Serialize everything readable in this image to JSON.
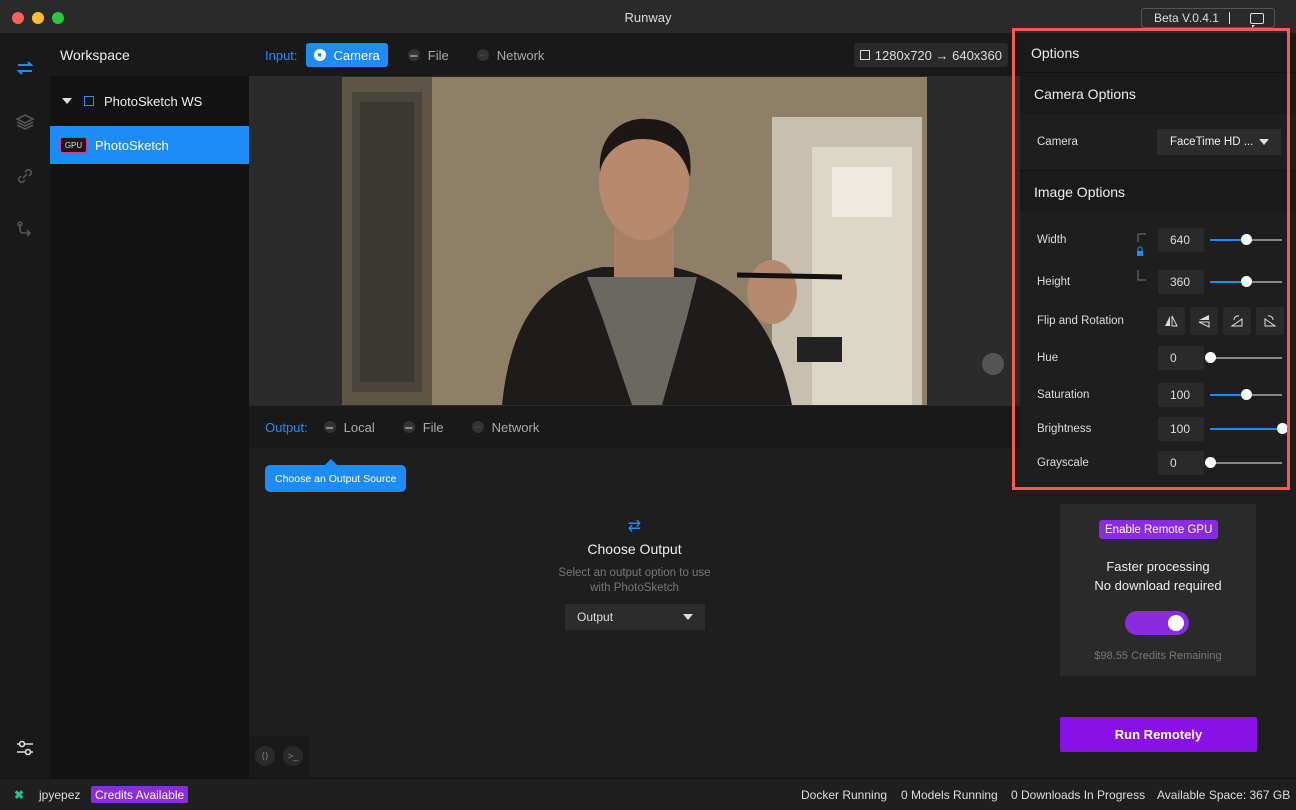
{
  "window": {
    "title": "Runway",
    "version": "Beta V.0.4.1"
  },
  "workspace": {
    "header": "Workspace",
    "name": "PhotoSketch WS",
    "model": {
      "badge": "GPU",
      "name": "PhotoSketch"
    }
  },
  "input": {
    "label": "Input:",
    "tabs": [
      {
        "label": "Camera",
        "active": true
      },
      {
        "label": "File",
        "active": false
      },
      {
        "label": "Network",
        "active": false
      }
    ],
    "resolution": "1280x720 → 640x360"
  },
  "output": {
    "label": "Output:",
    "tabs": [
      {
        "label": "Local"
      },
      {
        "label": "File"
      },
      {
        "label": "Network"
      }
    ],
    "tooltip": "Choose an Output Source",
    "choose_title": "Choose Output",
    "choose_desc_line1": "Select an output option to use",
    "choose_desc_line2": "with PhotoSketch",
    "select_value": "Output"
  },
  "options": {
    "header": "Options",
    "camera_section": "Camera Options",
    "camera_label": "Camera",
    "camera_value": "FaceTime HD ...",
    "image_section": "Image Options",
    "width": {
      "label": "Width",
      "value": "640",
      "level": 0.5
    },
    "height": {
      "label": "Height",
      "value": "360",
      "level": 0.5
    },
    "flip_label": "Flip and Rotation",
    "hue": {
      "label": "Hue",
      "value": "0",
      "level": 0.0
    },
    "saturation": {
      "label": "Saturation",
      "value": "100",
      "level": 0.5
    },
    "brightness": {
      "label": "Brightness",
      "value": "100",
      "level": 1.0
    },
    "grayscale": {
      "label": "Grayscale",
      "value": "0",
      "level": 0.0
    }
  },
  "remote": {
    "badge": "Enable Remote GPU",
    "line1": "Faster processing",
    "line2": "No download required",
    "credits": "$98.55 Credits Remaining",
    "run_button": "Run Remotely"
  },
  "status": {
    "user": "jpyepez",
    "credits_badge": "Credits Available",
    "docker": "Docker Running",
    "models": "0 Models Running",
    "downloads": "0 Downloads In Progress",
    "space": "Available Space: 367 GB"
  },
  "colors": {
    "accent": "#1d8cf8",
    "purple": "#8a2be2",
    "highlight": "#f25c54"
  }
}
